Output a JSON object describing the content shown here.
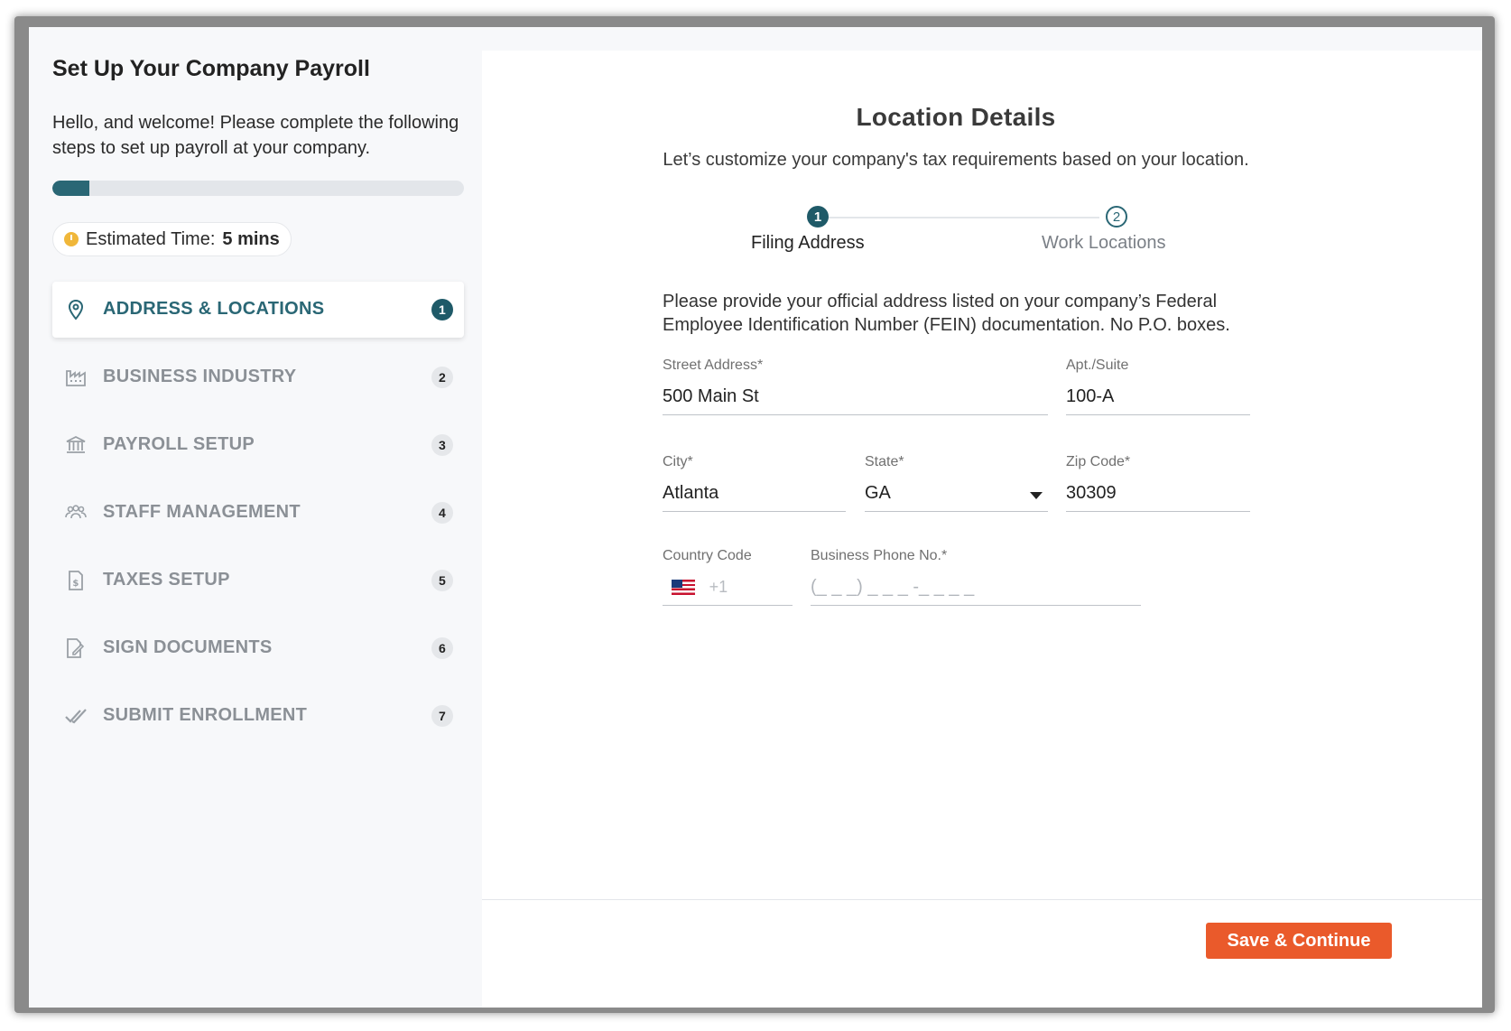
{
  "sidebar": {
    "title": "Set Up Your Company Payroll",
    "welcome": "Hello, and welcome! Please complete the following steps to set up payroll at your company.",
    "progress_percent": 9,
    "estimated_label": "Estimated Time:",
    "estimated_value": "5 mins",
    "items": [
      {
        "label": "ADDRESS & LOCATIONS",
        "badge": "1",
        "icon": "map-pin-icon",
        "active": true
      },
      {
        "label": "BUSINESS INDUSTRY",
        "badge": "2",
        "icon": "factory-icon",
        "active": false
      },
      {
        "label": "PAYROLL SETUP",
        "badge": "3",
        "icon": "bank-icon",
        "active": false
      },
      {
        "label": "STAFF MANAGEMENT",
        "badge": "4",
        "icon": "people-icon",
        "active": false
      },
      {
        "label": "TAXES SETUP",
        "badge": "5",
        "icon": "tax-document-icon",
        "active": false
      },
      {
        "label": "SIGN DOCUMENTS",
        "badge": "6",
        "icon": "sign-document-icon",
        "active": false
      },
      {
        "label": "SUBMIT ENROLLMENT",
        "badge": "7",
        "icon": "double-check-icon",
        "active": false
      }
    ]
  },
  "main": {
    "title": "Location Details",
    "subtitle": "Let’s customize your company's tax requirements based on your location.",
    "steps": [
      {
        "number": "1",
        "label": "Filing Address",
        "active": true
      },
      {
        "number": "2",
        "label": "Work Locations",
        "active": false
      }
    ],
    "instruction": "Please provide your official address listed on your company’s Federal Employee Identification Number (FEIN) documentation. No P.O. boxes.",
    "fields": {
      "street": {
        "label": "Street Address*",
        "value": "500 Main St"
      },
      "apt": {
        "label": "Apt./Suite",
        "value": "100-A"
      },
      "city": {
        "label": "City*",
        "value": "Atlanta"
      },
      "state": {
        "label": "State*",
        "value": "GA"
      },
      "zip": {
        "label": "Zip Code*",
        "value": "30309"
      },
      "country_code": {
        "label": "Country Code",
        "value": "+1",
        "flag": "us-flag-icon"
      },
      "phone": {
        "label": "Business Phone No.*",
        "placeholder": "(_ _ _) _ _ _ -_ _ _ _"
      }
    },
    "save_label": "Save & Continue"
  },
  "colors": {
    "accent": "#2a6775",
    "button": "#ea5a2b",
    "sidebar_bg": "#f7f8fa"
  }
}
